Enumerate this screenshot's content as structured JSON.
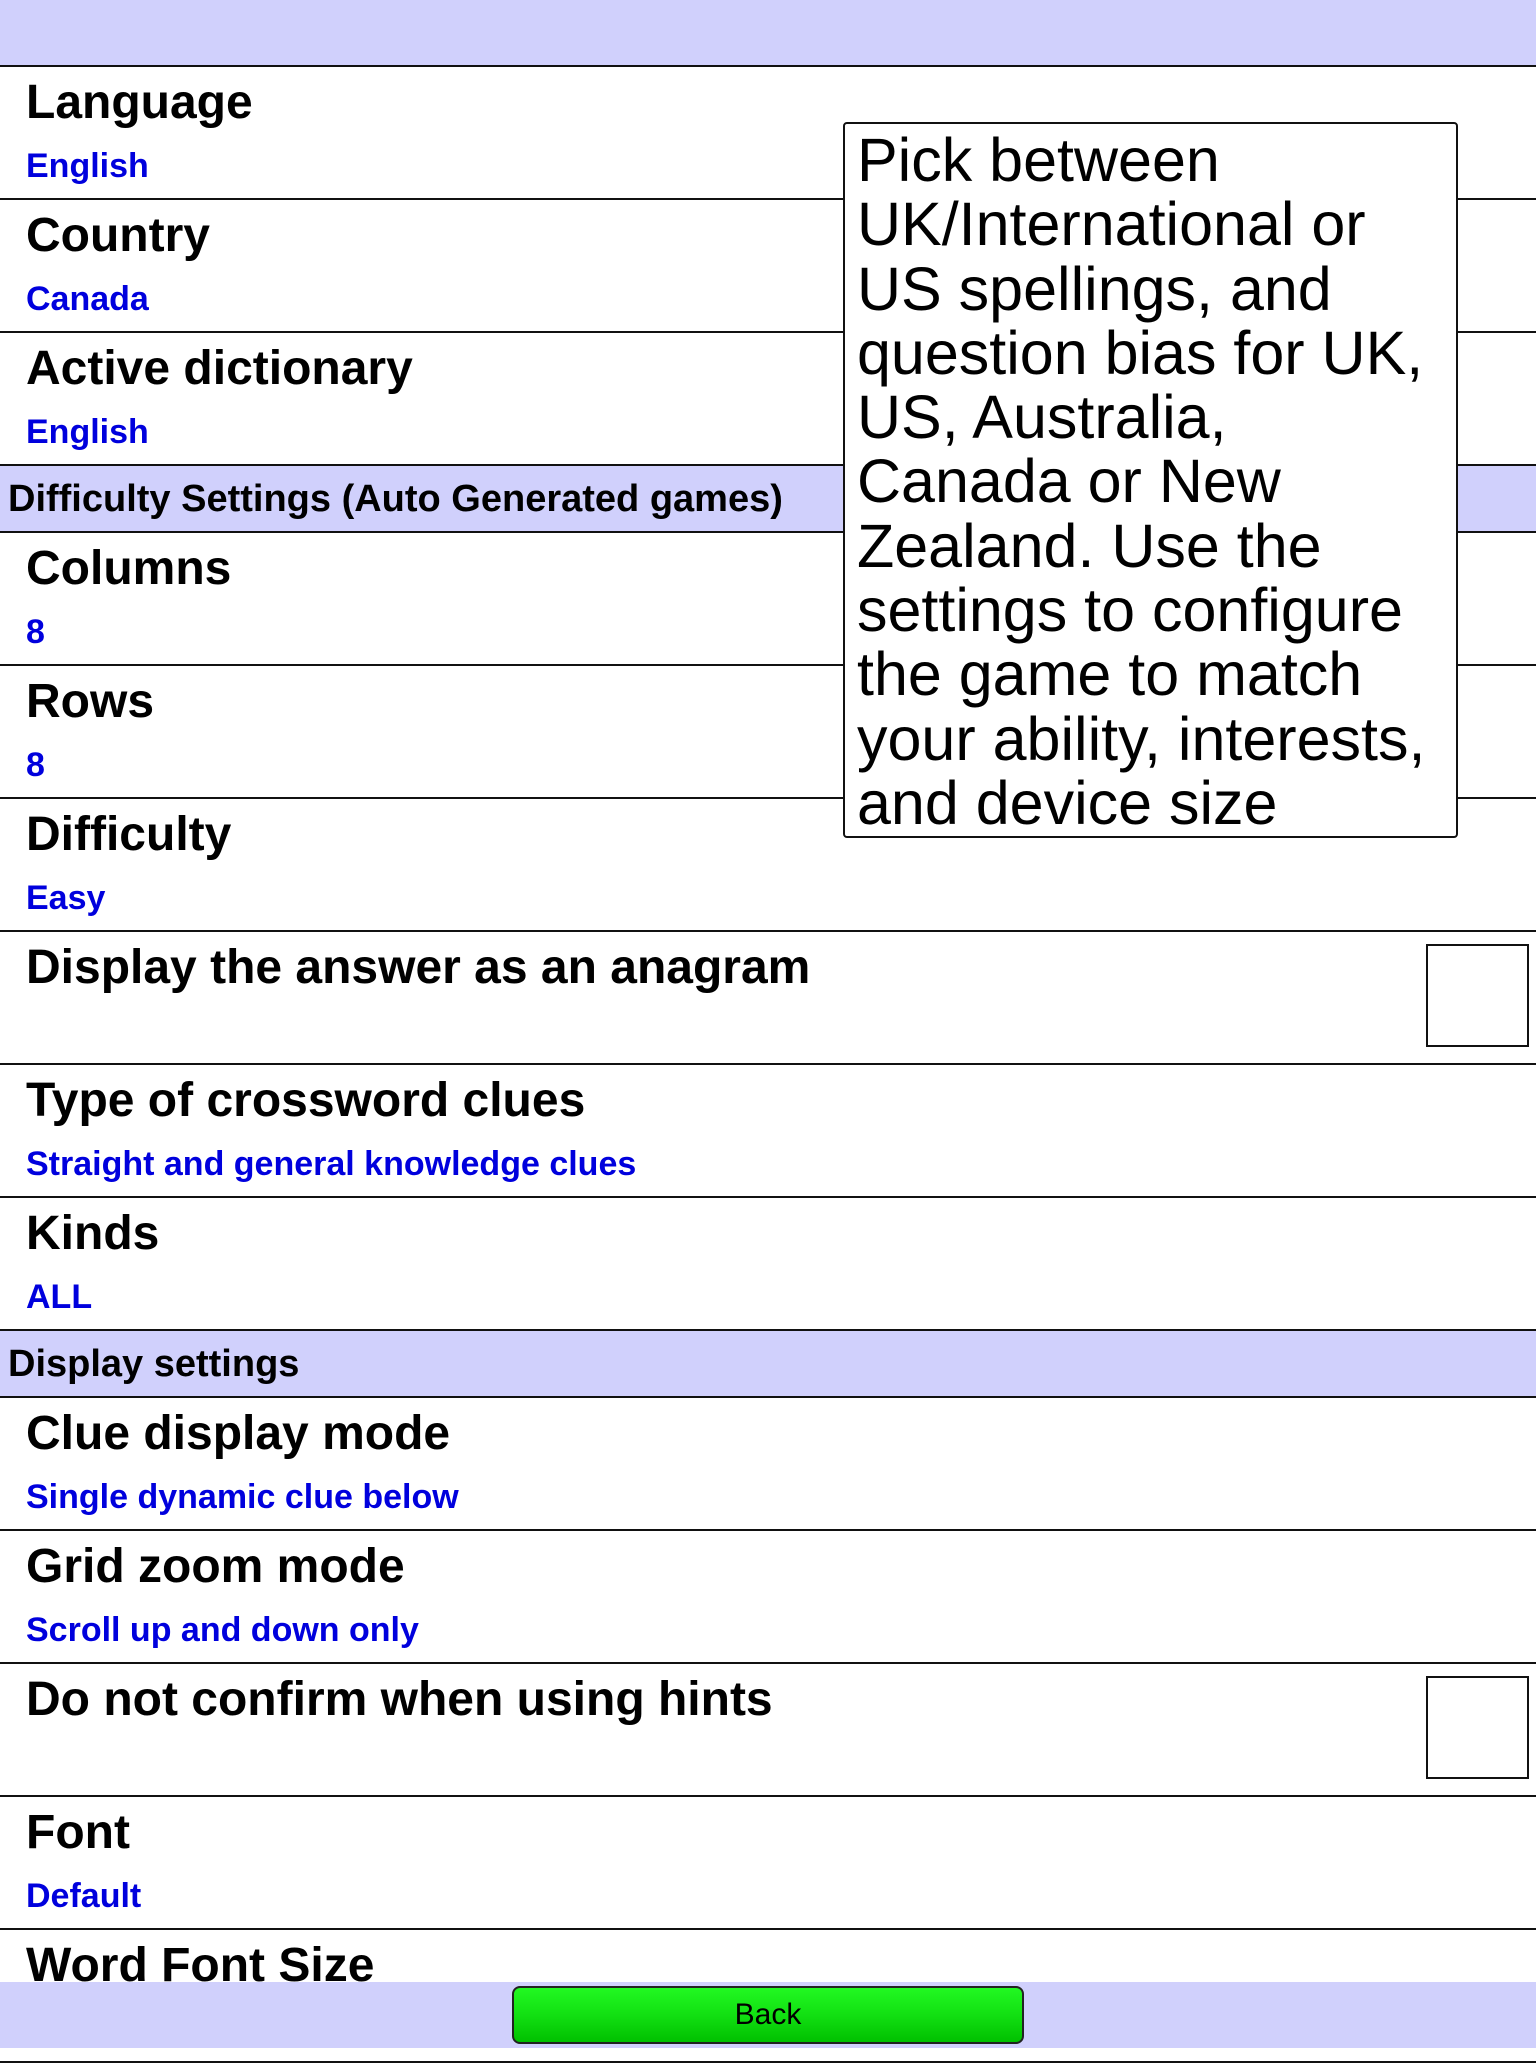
{
  "tooltip": {
    "text": "Pick between UK/International or US spellings, and question bias for UK, US, Australia, Canada or New Zealand. Use the settings to configure the game to match your ability, interests, and device size"
  },
  "general": [
    {
      "title": "Language",
      "value": "English"
    },
    {
      "title": "Country",
      "value": "Canada"
    },
    {
      "title": "Active dictionary",
      "value": "English"
    }
  ],
  "difficulty_section": {
    "label": "Difficulty Settings (Auto Generated games)",
    "items": [
      {
        "title": "Columns",
        "value": "8"
      },
      {
        "title": "Rows",
        "value": "8"
      },
      {
        "title": "Difficulty",
        "value": "Easy"
      },
      {
        "title": "Display the answer as an anagram",
        "checked": false
      },
      {
        "title": "Type of crossword clues",
        "value": "Straight and general knowledge clues"
      },
      {
        "title": "Kinds",
        "value": "ALL"
      }
    ]
  },
  "display_section": {
    "label": "Display settings",
    "items": [
      {
        "title": "Clue display mode",
        "value": "Single dynamic clue below"
      },
      {
        "title": "Grid zoom mode",
        "value": "Scroll up and down only"
      },
      {
        "title": "Do not confirm when using hints",
        "checked": false
      },
      {
        "title": "Font",
        "value": "Default"
      },
      {
        "title": "Word Font Size",
        "value": ""
      }
    ]
  },
  "footer": {
    "back_label": "Back"
  },
  "colors": {
    "header_bg": "#d0d0fc",
    "value_text": "#0000dd",
    "back_button": "#12e012"
  }
}
